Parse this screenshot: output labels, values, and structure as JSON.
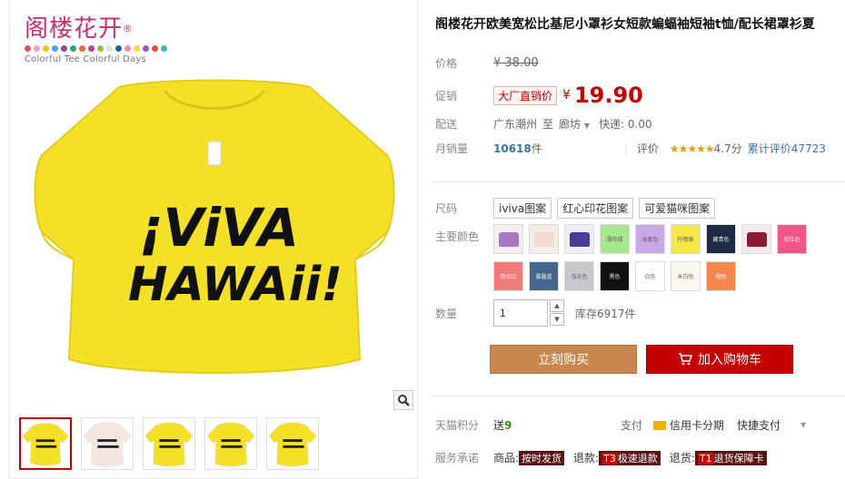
{
  "brand": {
    "name": "阁楼花开",
    "reg": "®",
    "slogan": "Colorful Tee Colorful Days",
    "dot_colors": [
      "#e94f6b",
      "#f7a1b6",
      "#f0c419",
      "#4aa3df",
      "#7a4fa3",
      "#2ea36b",
      "#e8663a",
      "#c93e8f",
      "#8cc63f",
      "#e0e0e0",
      "#1e5fa8",
      "#f08bb0",
      "#f6d84a",
      "#9b59b6",
      "#e74c3c",
      "#3cb3c7"
    ]
  },
  "product_image": {
    "print_line1": "¡ViVA",
    "print_line2": "HAWAii!",
    "shirt_color": "#f4e027"
  },
  "zoom_icon": "magnifier-icon",
  "thumbnails": [
    {
      "color": "#f4e027",
      "active": true
    },
    {
      "color": "#f7e6e0",
      "active": false
    },
    {
      "color": "#f4e027",
      "active": false
    },
    {
      "color": "#f4e027",
      "active": false
    },
    {
      "color": "#f4e027",
      "active": false
    }
  ],
  "title": "阁楼花开欧美宽松比基尼小罩衫女短款蝙蝠袖短袖t恤/配长裙罩衫夏",
  "price": {
    "label": "价格",
    "original": "¥ 38.00"
  },
  "promo": {
    "label": "促销",
    "tag": "大厂直销价",
    "currency": "¥",
    "value": "19.90"
  },
  "shipping": {
    "label": "配送",
    "from": "广东潮州",
    "to_word": "至",
    "to": "廊坊",
    "fee": "快递: 0.00"
  },
  "sales": {
    "label": "月销量",
    "count": "10618",
    "unit": "件",
    "review_label": "评价",
    "stars": "★★★★★",
    "score": "4.7分",
    "total_reviews": "累计评价47723"
  },
  "size": {
    "label": "尺码",
    "options": [
      "iviva图案",
      "红心印花图案",
      "可爱猫咪图案"
    ]
  },
  "colors": {
    "label": "主要颜色",
    "swatches": [
      {
        "bg": "#f2eef2",
        "tee": "#a879c2",
        "text": ""
      },
      {
        "bg": "#f5ede8",
        "tee": "#f3ddd2",
        "text": ""
      },
      {
        "bg": "#eeeef7",
        "tee": "#4a3a9a",
        "text": ""
      },
      {
        "bg": "#a8e88c",
        "tee": "#a8e88c",
        "text": "薄荷绿"
      },
      {
        "bg": "#c9a8e6",
        "tee": "#c9a8e6",
        "text": "浅紫色"
      },
      {
        "bg": "#f6e646",
        "tee": "#f6e646",
        "text": "柠檬黄"
      },
      {
        "bg": "#1f2a44",
        "tee": "#1f2a44",
        "text": "藏青色"
      },
      {
        "bg": "#f3eaec",
        "tee": "#8a1c34",
        "text": ""
      },
      {
        "bg": "#f2558a",
        "tee": "#f2558a",
        "text": "玫红色"
      },
      {
        "bg": "#f07b78",
        "tee": "#f07b78",
        "text": "西瓜红"
      },
      {
        "bg": "#44668f",
        "tee": "#44668f",
        "text": "雾霾蓝"
      },
      {
        "bg": "#c7c7cc",
        "tee": "#c7c7cc",
        "text": "浅灰色"
      },
      {
        "bg": "#111111",
        "tee": "#111111",
        "text": "黑色"
      },
      {
        "bg": "#ffffff",
        "tee": "#ffffff",
        "text": "白色"
      },
      {
        "bg": "#fbf8ee",
        "tee": "#fbf8ee",
        "text": "米白色"
      },
      {
        "bg": "#f4874e",
        "tee": "#f4874e",
        "text": "橙色"
      }
    ]
  },
  "quantity": {
    "label": "数量",
    "value": "1",
    "up": "▲",
    "down": "▼",
    "stock": "库存6917件"
  },
  "buttons": {
    "buy": "立刻购买",
    "cart": "加入购物车",
    "cart_icon": "cart-icon"
  },
  "points": {
    "label": "天猫积分",
    "prefix": "送",
    "value": "9",
    "pay_label": "支付",
    "credit": "信用卡分期",
    "quick": "快捷支付",
    "arrow": "▼"
  },
  "service": {
    "label": "服务承诺",
    "goods": "商品:",
    "goods_tag": "按时发货",
    "refund": "退款:",
    "refund_code": "T3",
    "refund_tag": "极速退款",
    "return": "退货:",
    "return_code": "T1",
    "return_tag": "退货保障卡"
  }
}
